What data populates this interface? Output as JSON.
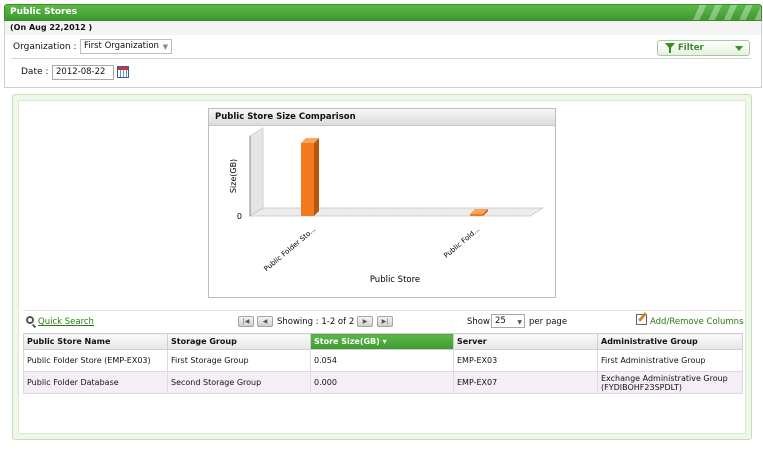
{
  "header": {
    "title": "Public Stores",
    "date_note": "(On Aug 22,2012 )"
  },
  "filters": {
    "org_label": "Organization :",
    "org_value": "First Organization",
    "filter_label": "Filter",
    "date_label": "Date :",
    "date_value": "2012-08-22"
  },
  "chart_data": {
    "type": "bar",
    "title": "Public Store Size Comparison",
    "xlabel": "Public Store",
    "ylabel": "Size(GB)",
    "categories": [
      "Public Folder Sto...",
      "Public Fold..."
    ],
    "values": [
      0.054,
      0.0
    ],
    "y_ticks": [
      "0"
    ],
    "colors": {
      "bar": "#f07a1c",
      "bar_dark": "#b85610",
      "bar_top": "#f9a55c"
    }
  },
  "grid": {
    "quick_search": "Quick Search",
    "showing": "Showing : 1-2 of 2",
    "show_label": "Show",
    "per_page_value": "25",
    "per_page_label": "per page",
    "add_remove": "Add/Remove Columns",
    "columns": [
      "Public Store Name",
      "Storage Group",
      "Store Size(GB) ▾",
      "Server",
      "Administrative Group"
    ],
    "rows": [
      [
        "Public Folder Store (EMP-EX03)",
        "First Storage Group",
        "0.054",
        "EMP-EX03",
        "First Administrative Group"
      ],
      [
        "Public Folder Database",
        "Second Storage Group",
        "0.000",
        "EMP-EX07",
        "Exchange Administrative Group (FYDIBOHF23SPDLT)"
      ]
    ]
  }
}
